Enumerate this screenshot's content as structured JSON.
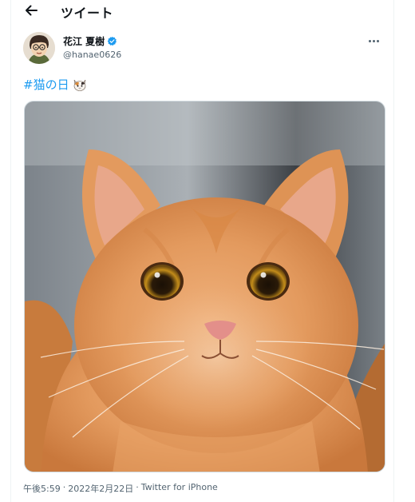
{
  "header": {
    "title": "ツイート"
  },
  "author": {
    "name": "花江 夏樹",
    "handle": "@hanae0626"
  },
  "tweet": {
    "hashtag": "#猫の日"
  },
  "meta": {
    "time": "午後5:59",
    "separator1": "·",
    "date": "2022年2月22日",
    "separator2": "·",
    "source": "Twitter for iPhone"
  },
  "icons": {
    "back": "back-arrow-icon",
    "verified": "verified-badge-icon",
    "more": "more-options-icon",
    "emoji": "cat-face-emoji"
  },
  "colors": {
    "link": "#1d9bf0",
    "secondary_text": "#536471",
    "verified": "#1d9bf0"
  }
}
